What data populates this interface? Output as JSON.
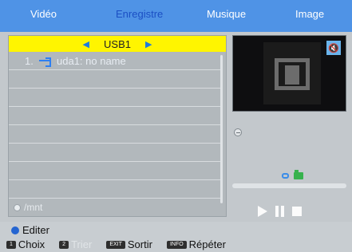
{
  "tabs": [
    {
      "label": "Vidéo",
      "active": false
    },
    {
      "label": "Enregistre",
      "active": true
    },
    {
      "label": "Musique",
      "active": false
    },
    {
      "label": "Image",
      "active": false
    }
  ],
  "browser": {
    "device": "USB1",
    "items": [
      {
        "index": "1.",
        "icon": "usb-icon",
        "label": "uda1: no name"
      }
    ],
    "path": "/mnt"
  },
  "player": {
    "mute_icon": "mute-icon",
    "progress": 0,
    "controls": [
      "play-icon",
      "pause-icon",
      "stop-icon"
    ]
  },
  "bottom": {
    "edit_label": "Editer",
    "keys": [
      {
        "cap": "1",
        "label": "Choix",
        "enabled": true
      },
      {
        "cap": "2",
        "label": "Trier",
        "enabled": false
      },
      {
        "cap": "EXIT",
        "label": "Sortir",
        "enabled": true
      },
      {
        "cap": "INFO",
        "label": "Répéter",
        "enabled": true
      }
    ]
  },
  "colors": {
    "tab_bar": "#4f93e6",
    "active_tab": "#1b4fc4",
    "header": "#fff500",
    "accent": "#1e7be0"
  }
}
